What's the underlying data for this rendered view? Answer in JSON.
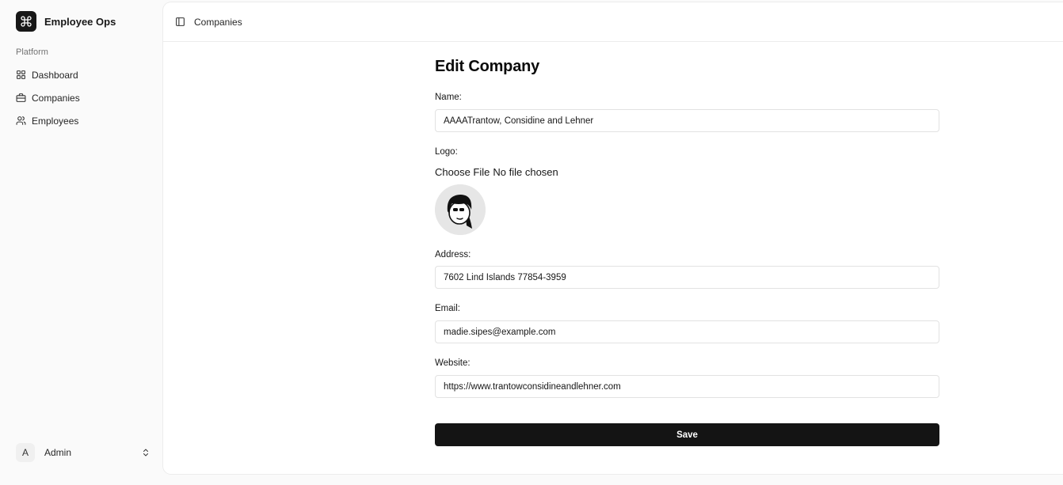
{
  "app": {
    "name": "Employee Ops"
  },
  "sidebar": {
    "section": "Platform",
    "items": [
      {
        "label": "Dashboard",
        "icon": "grid-icon"
      },
      {
        "label": "Companies",
        "icon": "briefcase-icon"
      },
      {
        "label": "Employees",
        "icon": "users-icon"
      }
    ],
    "user": {
      "initial": "A",
      "name": "Admin"
    }
  },
  "topbar": {
    "breadcrumb": "Companies"
  },
  "form": {
    "title": "Edit Company",
    "name_label": "Name:",
    "name_value": "AAAATrantow, Considine and Lehner",
    "logo_label": "Logo:",
    "file_button": "Choose File",
    "file_status": "No file chosen",
    "address_label": "Address:",
    "address_value": "7602 Lind Islands 77854-3959",
    "email_label": "Email:",
    "email_value": "madie.sipes@example.com",
    "website_label": "Website:",
    "website_value": "https://www.trantowconsidineandlehner.com",
    "save_label": "Save"
  }
}
